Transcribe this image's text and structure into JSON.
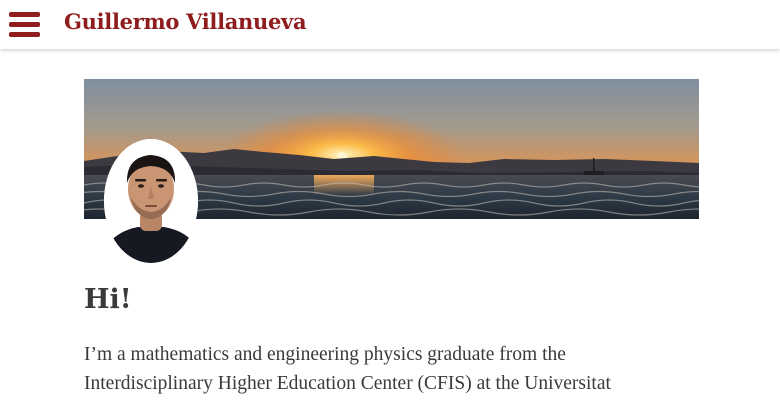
{
  "header": {
    "menu_icon": "hamburger-menu-icon",
    "site_title": "Guillermo Villanueva",
    "brand_color": "#8f1d1d"
  },
  "hero": {
    "banner_image": "sunset-over-sea-photo",
    "avatar_image": "profile-photo"
  },
  "content": {
    "greeting": "Hi!",
    "intro_line1": "I’m a mathematics and engineering physics graduate from the",
    "intro_line2": "Interdisciplinary Higher Education Center (CFIS) at the Universitat"
  }
}
